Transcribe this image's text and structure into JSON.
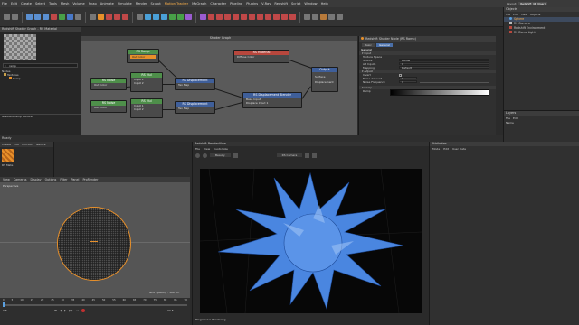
{
  "menu": {
    "items": [
      "File",
      "Edit",
      "Create",
      "Select",
      "Tools",
      "Mesh",
      "Volume",
      "Snap",
      "Animate",
      "Simulate",
      "Render",
      "Sculpt",
      "Motion Tracker",
      "MoGraph",
      "Character",
      "Pipeline",
      "Plugins",
      "V-Ray",
      "Redshift",
      "Script",
      "Window",
      "Help"
    ],
    "highlight": "Motion Tracker",
    "layout_label": "Layout:",
    "layout_value": "Redshift_4K (User)"
  },
  "left_panel": {
    "title": "Redshift Shader Graph - RS Material",
    "search_value": "ramp",
    "tree_header": "Nodes",
    "tree_items": [
      "Textures",
      "Ramp"
    ],
    "status": "Gradient ramp texture"
  },
  "shader_graph": {
    "title": "Shader Graph",
    "nodes": {
      "ramp": {
        "name": "RS Ramp",
        "ports": [
          "Out Color"
        ]
      },
      "noise1": {
        "name": "RS Noise",
        "ports": [
          "Out Color"
        ]
      },
      "mul1": {
        "name": "RS Mul",
        "ports": [
          "Input 1",
          "Out",
          "Input 2"
        ]
      },
      "noise2": {
        "name": "RS Noise",
        "ports": [
          "Out Color"
        ]
      },
      "mul2": {
        "name": "RS Mul",
        "ports": [
          "Input 1",
          "Out",
          "Input 2"
        ]
      },
      "disp1": {
        "name": "RS Displacement",
        "ports": [
          "Tex Map",
          "Out"
        ]
      },
      "disp2": {
        "name": "RS Displacement",
        "ports": [
          "Tex Map",
          "Out"
        ]
      },
      "blender": {
        "name": "RS Displacement Blender",
        "ports": [
          "Base Input",
          "Out",
          "Displace Input 1"
        ]
      },
      "material": {
        "name": "RS Material",
        "ports": [
          "Diffuse Color",
          "Out Color"
        ]
      },
      "output": {
        "name": "Output",
        "ports": [
          "Surface",
          "Displacement"
        ]
      }
    }
  },
  "attr_panel": {
    "title": "Redshift Shader Node (RS Ramp)",
    "tabs": [
      "Basic",
      "General"
    ],
    "section": "General",
    "group_input": "Input",
    "rows": [
      {
        "label": "Texture Space",
        "value": ""
      },
      {
        "label": "Source",
        "value": "Radial"
      },
      {
        "label": "Alt Inputs",
        "value": "0"
      },
      {
        "label": "Mapping",
        "value": "Default"
      }
    ],
    "group_adjust": "Adjust",
    "adjust_rows": [
      {
        "label": "Invert",
        "value": ""
      },
      {
        "label": "Noise Amount",
        "value": "0"
      },
      {
        "label": "Noise Frequency",
        "value": "1"
      }
    ],
    "group_ramp": "Ramp",
    "ramp_label": "Ramp"
  },
  "objects": {
    "menu": [
      "File",
      "Edit",
      "View",
      "Objects"
    ],
    "title": "Objects",
    "items": [
      "Sphere",
      "RS Camera",
      "Redshift Environment",
      "RS Dome Light"
    ]
  },
  "layers": {
    "title": "Layers",
    "menu": [
      "File",
      "Edit"
    ],
    "name_label": "Name"
  },
  "ready": "Ready",
  "material_mgr": {
    "menu": [
      "Create",
      "Edit",
      "Function",
      "Texture"
    ],
    "mat_label": "RS Mate"
  },
  "viewport": {
    "menu": [
      "View",
      "Cameras",
      "Display",
      "Options",
      "Filter",
      "Panel",
      "ProRender"
    ],
    "label": "Perspective",
    "grid_spacing": "Grid Spacing : 100 cm"
  },
  "timeline": {
    "ticks": [
      "0",
      "5",
      "10",
      "15",
      "20",
      "25",
      "30",
      "35",
      "40",
      "45",
      "50",
      "55",
      "60",
      "65",
      "70",
      "75",
      "80",
      "85",
      "90"
    ],
    "frame_start": "0 F",
    "frame_end": "90 F"
  },
  "renderview": {
    "title": "Redshift RenderView",
    "menu": [
      "File",
      "View",
      "Customize"
    ],
    "beauty": "Beauty",
    "camera": "RS Camera",
    "status": "Progressive Rendering..."
  },
  "attributes": {
    "title": "Attributes",
    "menu": [
      "Mode",
      "Edit",
      "User Data"
    ]
  },
  "colors": {
    "accent_orange": "#e8902a",
    "node_header_red": "#b8473d",
    "node_header_green": "#4e8f4a",
    "node_header_blue": "#3f5f9a",
    "render_blue": "#4a86e0"
  }
}
